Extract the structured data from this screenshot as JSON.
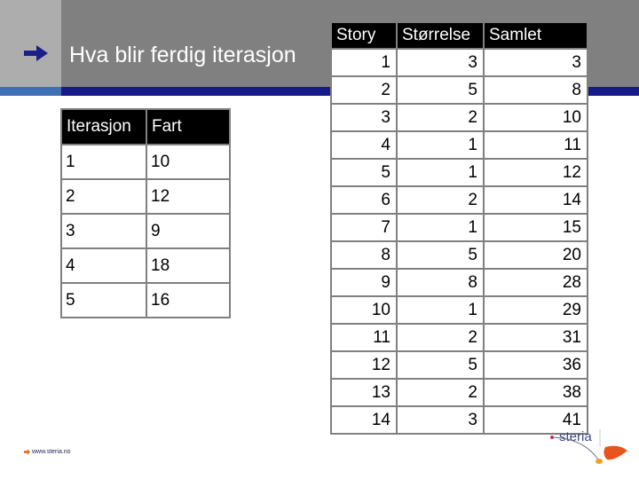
{
  "slide": {
    "title": "Hva blir ferdig iterasjon",
    "bullet_icon": "arrow-right-icon",
    "colors": {
      "header_gray": "#808080",
      "header_left_gray": "#adadad",
      "accent_bar_blue": "#161a8a",
      "accent_bar_left_blue": "#3f6fb5",
      "arrow_blue": "#1c1f8a",
      "table_header_bg": "#000000",
      "logo_orange": "#e8541c"
    }
  },
  "velocity_table": {
    "headers": [
      "Iterasjon",
      "Fart"
    ],
    "rows": [
      [
        "1",
        "10"
      ],
      [
        "2",
        "12"
      ],
      [
        "3",
        "9"
      ],
      [
        "4",
        "18"
      ],
      [
        "5",
        "16"
      ]
    ]
  },
  "story_table": {
    "headers": [
      "Story",
      "Størrelse",
      "Samlet"
    ],
    "rows": [
      [
        "1",
        "3",
        "3"
      ],
      [
        "2",
        "5",
        "8"
      ],
      [
        "3",
        "2",
        "10"
      ],
      [
        "4",
        "1",
        "11"
      ],
      [
        "5",
        "1",
        "12"
      ],
      [
        "6",
        "2",
        "14"
      ],
      [
        "7",
        "1",
        "15"
      ],
      [
        "8",
        "5",
        "20"
      ],
      [
        "9",
        "8",
        "28"
      ],
      [
        "10",
        "1",
        "29"
      ],
      [
        "11",
        "2",
        "31"
      ],
      [
        "12",
        "5",
        "36"
      ],
      [
        "13",
        "2",
        "38"
      ],
      [
        "14",
        "3",
        "41"
      ]
    ]
  },
  "footer": {
    "url": "www.steria.no",
    "logo_text": "steria"
  }
}
